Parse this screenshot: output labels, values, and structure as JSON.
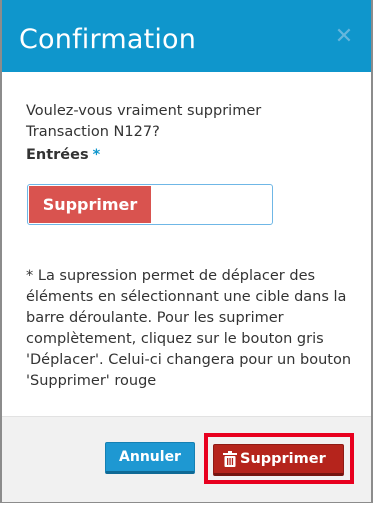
{
  "dialog": {
    "title": "Confirmation",
    "close_glyph": "✕",
    "question_line1": "Voulez-vous vraiment supprimer",
    "question_line2": "Transaction N127?",
    "entries_label": "Entrées",
    "entries_required": "*",
    "toggle": {
      "selected": "Supprimer",
      "unselected": ""
    },
    "note": "* La supression permet de déplacer des éléments en sélectionnant une cible dans la barre déroulante. Pour les suprimer complètement, cliquez sur le bouton gris 'Déplacer'. Celui-ci changera pour un bouton 'Supprimer' rouge",
    "buttons": {
      "cancel": "Annuler",
      "delete": "Supprimer",
      "delete_icon": "trash-icon"
    }
  },
  "colors": {
    "header": "#0f96cc",
    "delete_button": "#b5241c",
    "toggle_active": "#d9534f",
    "cancel_button": "#1e98d2",
    "highlight": "#e8001f"
  }
}
